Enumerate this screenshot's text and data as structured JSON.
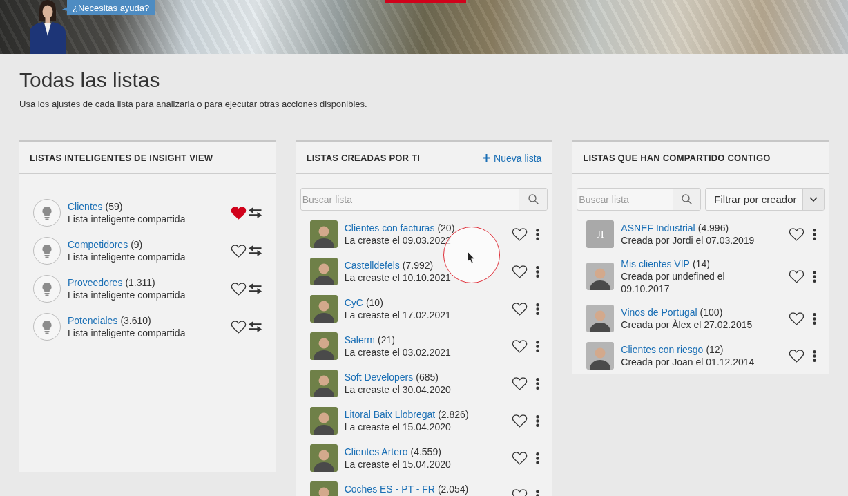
{
  "banner": {
    "help": "¿Necesitas ayuda?"
  },
  "page": {
    "title": "Todas las listas",
    "description": "Usa los ajustes de cada lista para analizarla o para ejecutar otras acciones disponibles."
  },
  "panels": [
    {
      "title": "LISTAS INTELIGENTES DE INSIGHT VIEW",
      "items": [
        {
          "kind": "smart",
          "name": "Clientes",
          "count": "(59)",
          "subtitle": "Lista inteligente compartida",
          "favorite": true
        },
        {
          "kind": "smart",
          "name": "Competidores",
          "count": "(9)",
          "subtitle": "Lista inteligente compartida",
          "favorite": false
        },
        {
          "kind": "smart",
          "name": "Proveedores",
          "count": "(1.311)",
          "subtitle": "Lista inteligente compartida",
          "favorite": false
        },
        {
          "kind": "smart",
          "name": "Potenciales",
          "count": "(3.610)",
          "subtitle": "Lista inteligente compartida",
          "favorite": false
        }
      ]
    },
    {
      "title": "LISTAS CREADAS POR TI",
      "action": "Nueva lista",
      "search": {
        "placeholder": "Buscar lista"
      },
      "items": [
        {
          "kind": "photo",
          "name": "Clientes con facturas",
          "count": "(20)",
          "subtitle": "La creaste el 09.03.2022",
          "favorite": false
        },
        {
          "kind": "photo",
          "name": "Castelldefels",
          "count": "(7.992)",
          "subtitle": "La creaste el 10.10.2021",
          "favorite": false
        },
        {
          "kind": "photo",
          "name": "CyC",
          "count": "(10)",
          "subtitle": "La creaste el 17.02.2021",
          "favorite": false
        },
        {
          "kind": "photo",
          "name": "Salerm",
          "count": "(21)",
          "subtitle": "La creaste el 03.02.2021",
          "favorite": false
        },
        {
          "kind": "photo",
          "name": "Soft Developers",
          "count": "(685)",
          "subtitle": "La creaste el 30.04.2020",
          "favorite": false
        },
        {
          "kind": "photo",
          "name": "Litoral Baix Llobregat",
          "count": "(2.826)",
          "subtitle": "La creaste el 15.04.2020",
          "favorite": false
        },
        {
          "kind": "photo",
          "name": "Clientes Artero",
          "count": "(4.559)",
          "subtitle": "La creaste el 15.04.2020",
          "favorite": false
        },
        {
          "kind": "photo",
          "name": "Coches ES - PT - FR",
          "count": "(2.054)",
          "favorite": false
        }
      ]
    },
    {
      "title": "LISTAS QUE HAN COMPARTIDO CONTIGO",
      "search": {
        "placeholder": "Buscar lista"
      },
      "filter": "Filtrar por creador",
      "items": [
        {
          "kind": "initials",
          "initials": "JI",
          "name": "ASNEF Industrial",
          "count": "(4.996)",
          "subtitle": "Creada por Jordi el 07.03.2019",
          "favorite": false
        },
        {
          "kind": "photo",
          "name": "Mis clientes VIP",
          "count": "(14)",
          "subtitle": "Creada por undefined el 09.10.2017",
          "favorite": false
        },
        {
          "kind": "photo",
          "name": "Vinos de Portugal",
          "count": "(100)",
          "subtitle": "Creada por Àlex el 27.02.2015",
          "favorite": false
        },
        {
          "kind": "photo",
          "name": "Clientes con riesgo",
          "count": "(12)",
          "subtitle": "Creada por Joan el 01.12.2014",
          "favorite": false
        }
      ]
    }
  ],
  "pointer": {
    "click_highlight": true
  }
}
